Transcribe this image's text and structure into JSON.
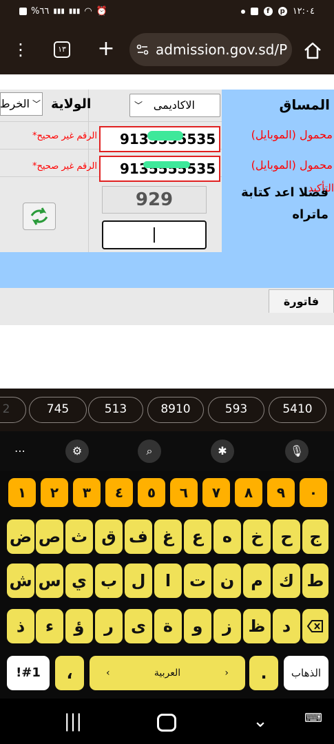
{
  "status_bar": {
    "time": "١٢:٠٤",
    "battery": "%٦٦",
    "icons": [
      "battery-icon",
      "signal-icon",
      "signal-icon",
      "wifi-icon",
      "alarm-icon",
      "dot-icon",
      "gallery-icon",
      "facebook-icon",
      "pinterest-icon"
    ]
  },
  "browser": {
    "url": "admission.gov.sd/P",
    "tab_count": "١٣"
  },
  "form": {
    "state_label": "الولاية",
    "state_value": "الخرط",
    "track_label": "المساق",
    "track_value": "الاكاديمى",
    "mobile_label": "محمول (الموبايل)",
    "mobile_value": "9135555535",
    "mobile_confirm_label": "محمول (الموبايل)",
    "mobile_confirm_overlay": "التأكيد",
    "mobile_confirm_value": "9135555535",
    "invalid_msg_1": "*الرقم غير صحيح",
    "invalid_msg_2": "*الرقم غير صحيح",
    "captcha_value": "929",
    "captcha_prompt": "فضلا اعد كتابة ماتراه",
    "captcha_input": "|",
    "invoice_tab": "فاتورة"
  },
  "suggestions": [
    "2",
    "745",
    "513",
    "8910",
    "593",
    "5410"
  ],
  "keyboard": {
    "numbers": [
      "١",
      "٢",
      "٣",
      "٤",
      "٥",
      "٦",
      "٧",
      "٨",
      "٩",
      "٠"
    ],
    "row1": [
      "ض",
      "ص",
      "ث",
      "ق",
      "ف",
      "غ",
      "ع",
      "ه",
      "خ",
      "ح",
      "ج"
    ],
    "row2": [
      "ش",
      "س",
      "ي",
      "ب",
      "ل",
      "ا",
      "ت",
      "ن",
      "م",
      "ك",
      "ط"
    ],
    "row3": [
      "ذ",
      "ء",
      "ؤ",
      "ر",
      "ى",
      "ة",
      "و",
      "ز",
      "ظ",
      "د"
    ],
    "symbols_key": "!#1",
    "comma_key": "،",
    "space_label": "العربية",
    "period_key": ".",
    "go_key": "الذهاب",
    "backspace_icon": "backspace-icon"
  },
  "colors": {
    "status_bg": "#241a14",
    "form_blue": "#99ccff",
    "key_yellow": "#f0e158",
    "key_orange": "#ffb000"
  }
}
